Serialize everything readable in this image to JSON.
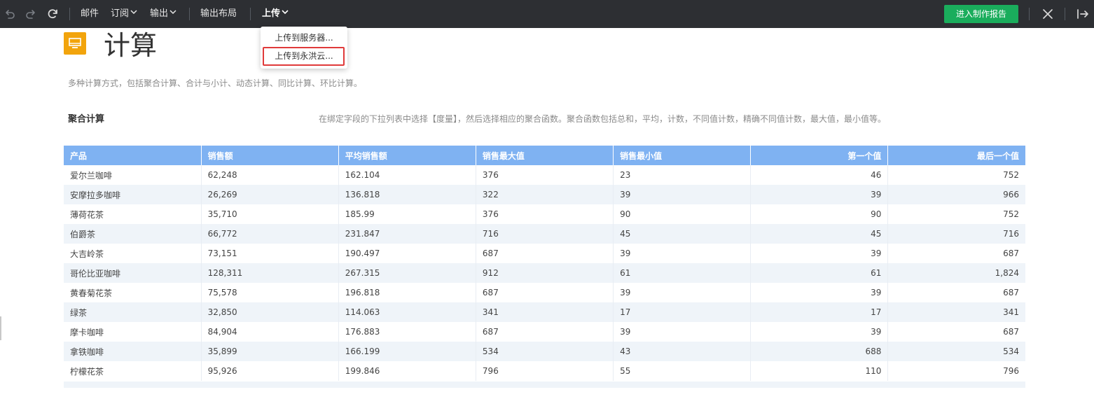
{
  "toolbar": {
    "icons": [
      "undo-icon",
      "redo-icon",
      "refresh-icon",
      "close-icon",
      "exit-icon"
    ],
    "mail_label": "邮件",
    "subscribe_label": "订阅",
    "export_label": "输出",
    "export_layout_label": "输出布局",
    "upload_label": "上传",
    "enter_report_label": "进入制作报告",
    "accent": "#1aad5c",
    "background": "#2d2f33"
  },
  "upload_menu": {
    "items": [
      {
        "label": "上传到服务器..."
      },
      {
        "label": "上传到永洪云..."
      }
    ],
    "highlight_color": "#e03a3a"
  },
  "page": {
    "icon": "monitor-icon",
    "icon_color": "#f2a40c",
    "title": "计算",
    "description": "多种计算方式，包括聚合计算、合计与小计、动态计算、同比计算、环比计算。"
  },
  "section": {
    "title": "聚合计算",
    "description": "在绑定字段的下拉列表中选择【度量】，然后选择相应的聚合函数。聚合函数包括总和，平均，计数，不同值计数，精确不同值计数，最大值，最小值等。"
  },
  "table": {
    "header_color": "#7fb2f2",
    "columns": [
      "产品",
      "销售额",
      "平均销售额",
      "销售最大值",
      "销售最小值",
      "第一个值",
      "最后一个值"
    ],
    "rows": [
      [
        "爱尔兰咖啡",
        "62,248",
        "162.104",
        "376",
        "23",
        "46",
        "752"
      ],
      [
        "安摩拉多咖啡",
        "26,269",
        "136.818",
        "322",
        "39",
        "39",
        "966"
      ],
      [
        "薄荷花茶",
        "35,710",
        "185.99",
        "376",
        "90",
        "90",
        "752"
      ],
      [
        "伯爵茶",
        "66,772",
        "231.847",
        "716",
        "45",
        "45",
        "716"
      ],
      [
        "大吉岭茶",
        "73,151",
        "190.497",
        "687",
        "39",
        "39",
        "687"
      ],
      [
        "哥伦比亚咖啡",
        "128,311",
        "267.315",
        "912",
        "61",
        "61",
        "1,824"
      ],
      [
        "黄春菊花茶",
        "75,578",
        "196.818",
        "687",
        "39",
        "39",
        "687"
      ],
      [
        "绿茶",
        "32,850",
        "114.063",
        "341",
        "17",
        "17",
        "341"
      ],
      [
        "摩卡咖啡",
        "84,904",
        "176.883",
        "687",
        "39",
        "39",
        "687"
      ],
      [
        "拿铁咖啡",
        "35,899",
        "166.199",
        "534",
        "43",
        "688",
        "534"
      ],
      [
        "柠檬花茶",
        "95,926",
        "199.846",
        "796",
        "55",
        "110",
        "796"
      ]
    ]
  }
}
